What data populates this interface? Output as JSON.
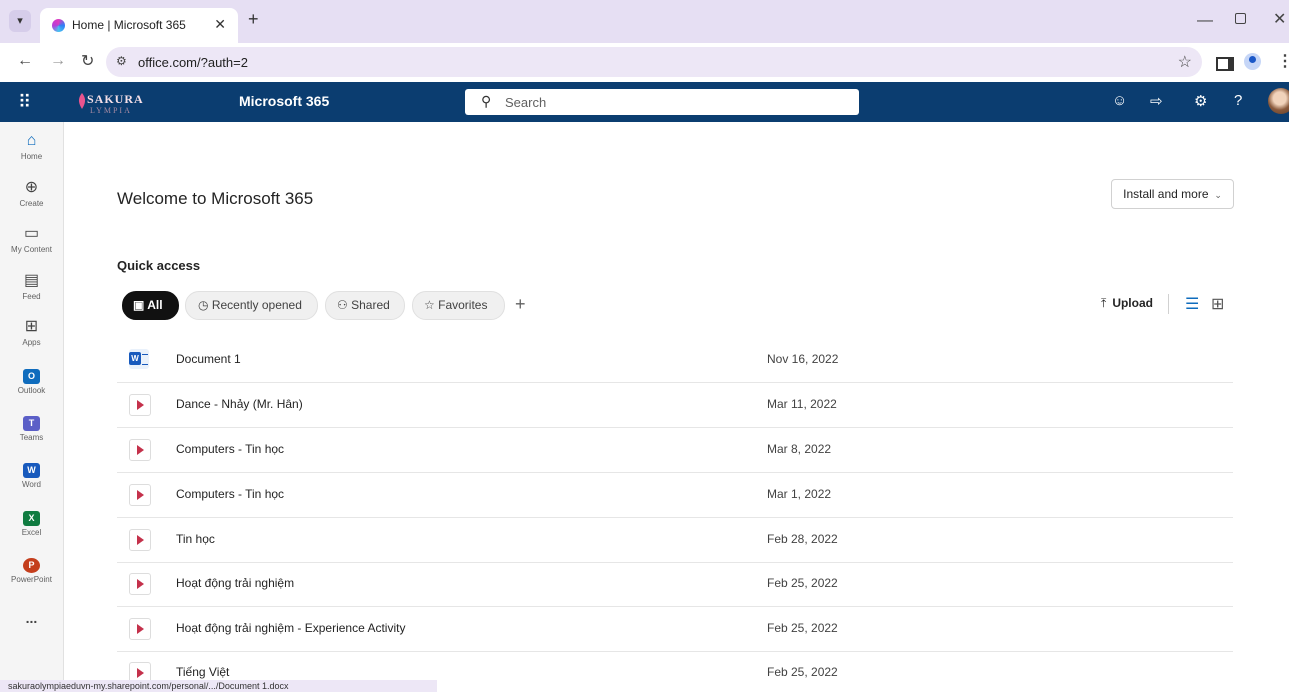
{
  "browser": {
    "tab_title": "Home | Microsoft 365",
    "url": "office.com/?auth=2",
    "status_url": "sakuraolympiaeduvn-my.sharepoint.com/personal/.../Document 1.docx"
  },
  "header": {
    "org_logo_text": "SAKURA",
    "org_logo_sub": "LYMPIA",
    "brand": "Microsoft 365",
    "search_placeholder": "Search"
  },
  "rail": {
    "home": "Home",
    "create": "Create",
    "my_content": "My Content",
    "feed": "Feed",
    "apps": "Apps",
    "outlook": "Outlook",
    "teams": "Teams",
    "word": "Word",
    "excel": "Excel",
    "powerpoint": "PowerPoint",
    "more": "..."
  },
  "main": {
    "welcome": "Welcome to Microsoft 365",
    "install_button": "Install and more",
    "quick_access_title": "Quick access",
    "filters": [
      "All",
      "Recently opened",
      "Shared",
      "Favorites"
    ],
    "upload_label": "Upload",
    "files": [
      {
        "name": "Document 1",
        "date": "Nov 16, 2022",
        "type": "word"
      },
      {
        "name": "Dance - Nhảy (Mr. Hân)",
        "date": "Mar 11, 2022",
        "type": "video"
      },
      {
        "name": "Computers - Tin học",
        "date": "Mar 8, 2022",
        "type": "video"
      },
      {
        "name": "Computers - Tin học",
        "date": "Mar 1, 2022",
        "type": "video"
      },
      {
        "name": "Tin học",
        "date": "Feb 28, 2022",
        "type": "video"
      },
      {
        "name": "Hoạt động trải nghiệm",
        "date": "Feb 25, 2022",
        "type": "video"
      },
      {
        "name": "Hoạt động trải nghiệm - Experience Activity",
        "date": "Feb 25, 2022",
        "type": "video"
      },
      {
        "name": "Tiếng Việt",
        "date": "Feb 25, 2022",
        "type": "video"
      }
    ]
  },
  "colors": {
    "header_bg": "#0b3d70",
    "tabbar_bg": "#e6dff3",
    "accent": "#0f6cbd"
  }
}
